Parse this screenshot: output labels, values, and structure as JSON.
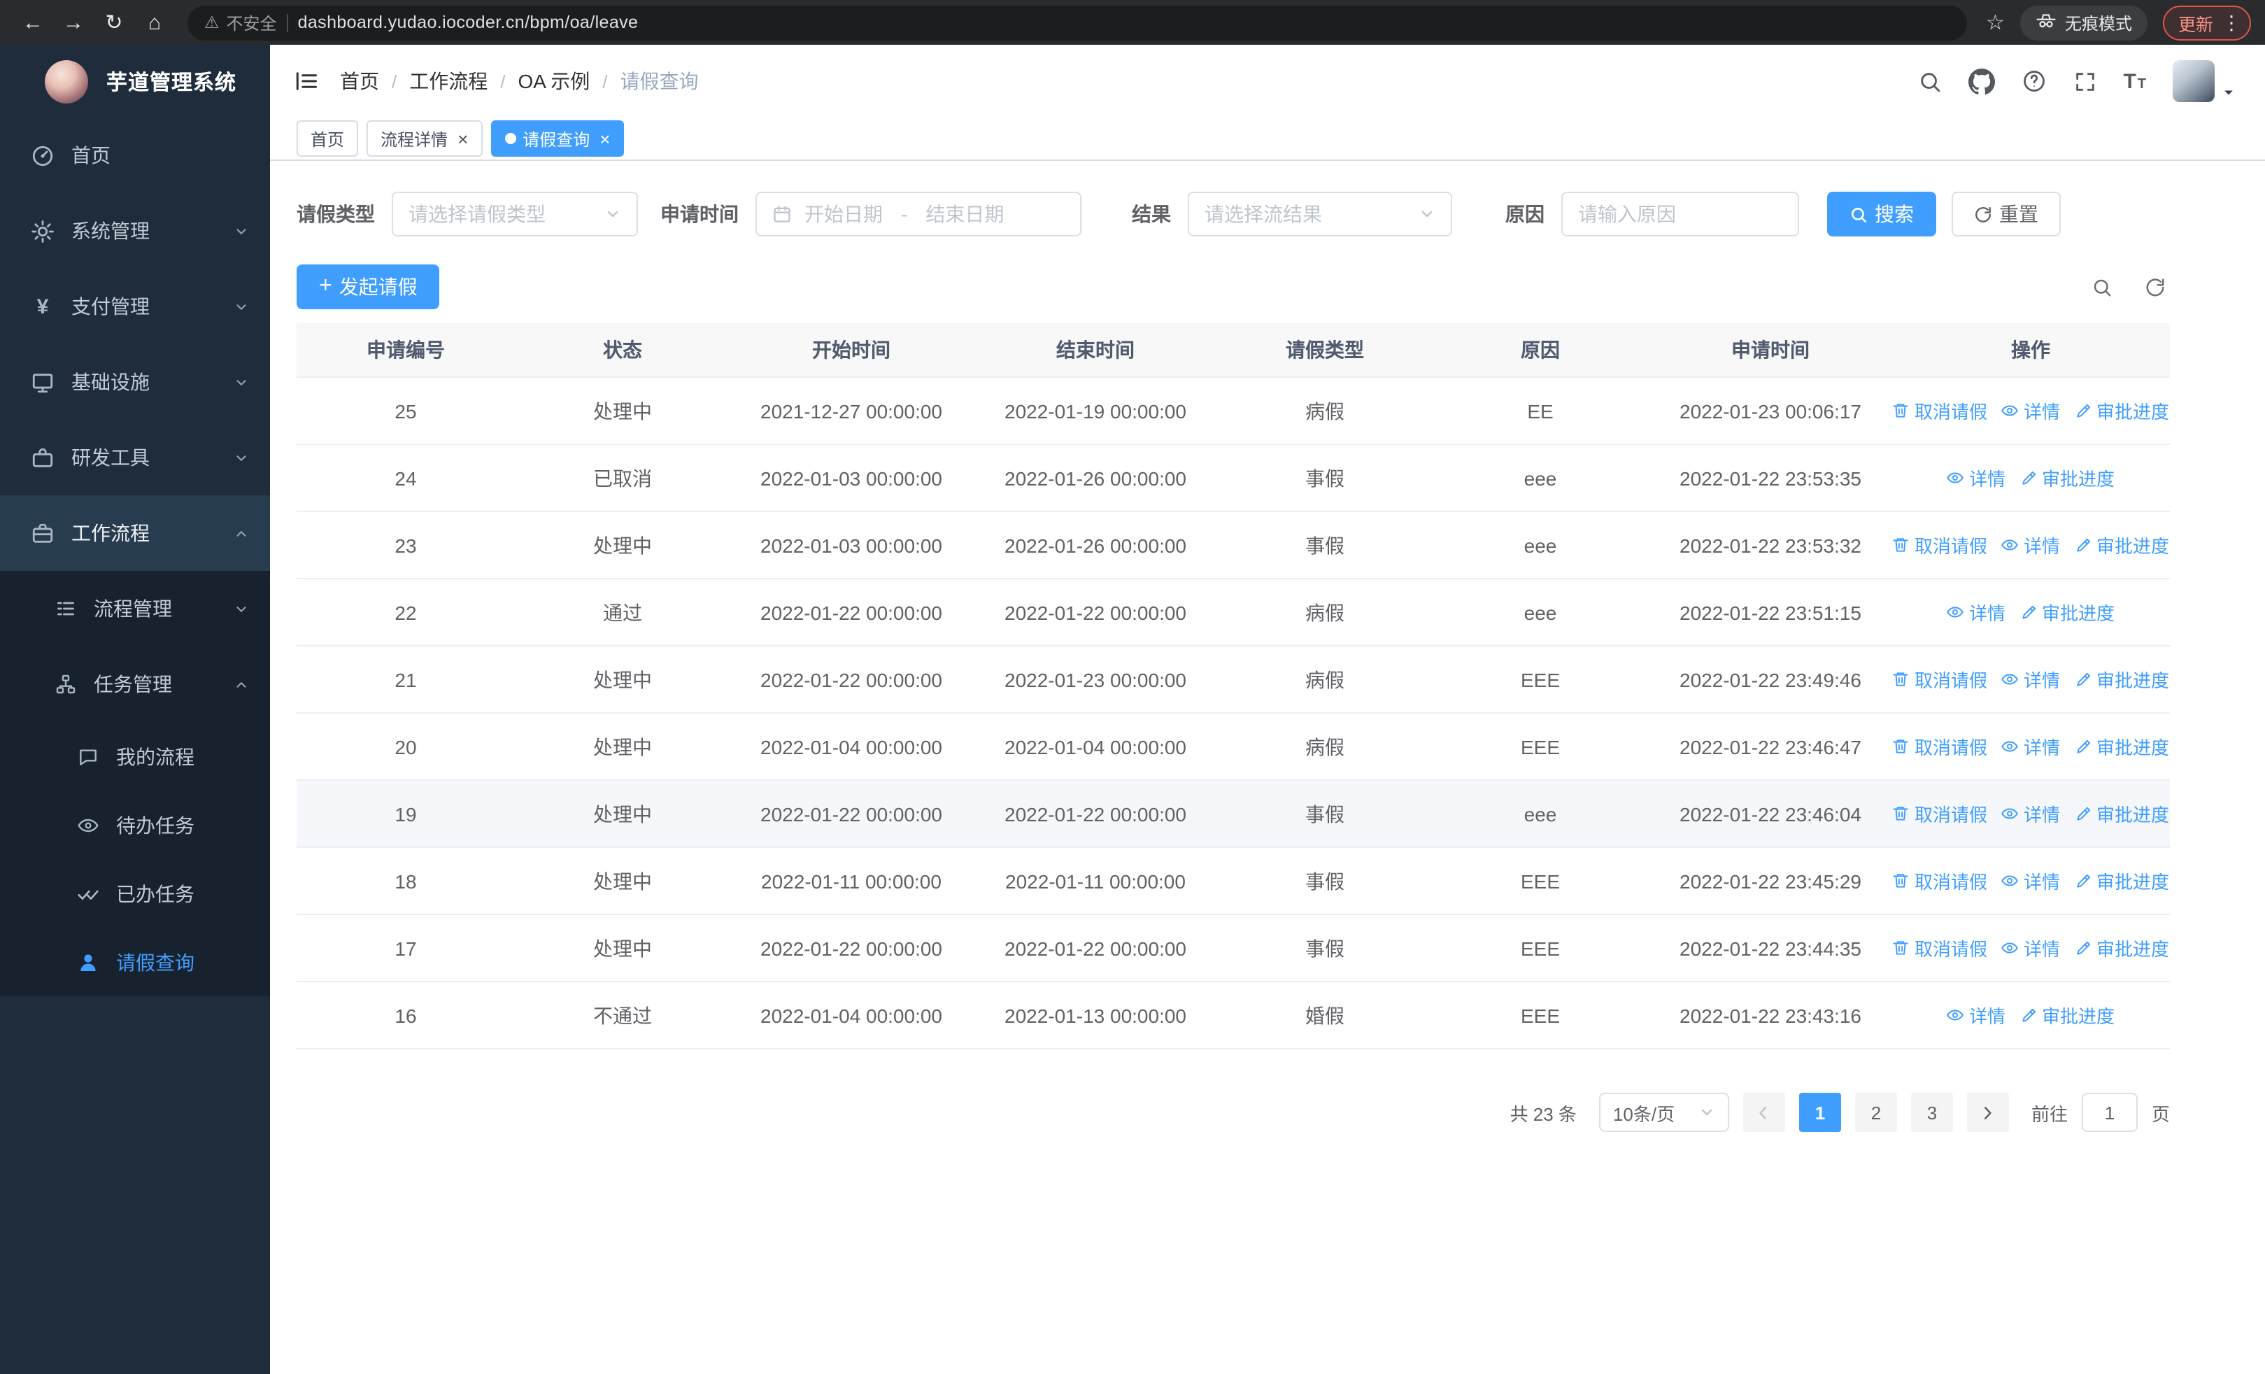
{
  "browser": {
    "security_warning": "不安全",
    "url": "dashboard.yudao.iocoder.cn/bpm/oa/leave",
    "incognito_label": "无痕模式",
    "update_label": "更新"
  },
  "sidebar": {
    "app_title": "芋道管理系统",
    "items": [
      {
        "key": "home",
        "label": "首页",
        "icon": "dashboard-icon",
        "level": 1
      },
      {
        "key": "system",
        "label": "系统管理",
        "icon": "gear-icon",
        "level": 1,
        "chevron": "down"
      },
      {
        "key": "payment",
        "label": "支付管理",
        "icon": "yen-icon",
        "level": 1,
        "chevron": "down"
      },
      {
        "key": "infra",
        "label": "基础设施",
        "icon": "monitor-icon",
        "level": 1,
        "chevron": "down"
      },
      {
        "key": "devtools",
        "label": "研发工具",
        "icon": "toolbox-icon",
        "level": 1,
        "chevron": "down"
      },
      {
        "key": "workflow",
        "label": "工作流程",
        "icon": "briefcase-icon",
        "level": 1,
        "chevron": "up",
        "open": true
      },
      {
        "key": "process-mgmt",
        "label": "流程管理",
        "icon": "list-icon",
        "level": 2,
        "chevron": "down"
      },
      {
        "key": "task-mgmt",
        "label": "任务管理",
        "icon": "org-icon",
        "level": 2,
        "chevron": "up",
        "open": true
      },
      {
        "key": "my-process",
        "label": "我的流程",
        "icon": "chat-icon",
        "level": 3
      },
      {
        "key": "todo-task",
        "label": "待办任务",
        "icon": "eye-icon",
        "level": 3
      },
      {
        "key": "done-task",
        "label": "已办任务",
        "icon": "double-check-icon",
        "level": 3
      },
      {
        "key": "leave-query",
        "label": "请假查询",
        "icon": "user-icon",
        "level": 3,
        "active": true
      }
    ]
  },
  "header": {
    "breadcrumb": [
      "首页",
      "工作流程",
      "OA 示例",
      "请假查询"
    ]
  },
  "tabs": [
    {
      "key": "home",
      "label": "首页",
      "closable": false,
      "active": false
    },
    {
      "key": "process-detail",
      "label": "流程详情",
      "closable": true,
      "active": false
    },
    {
      "key": "leave-query",
      "label": "请假查询",
      "closable": true,
      "active": true
    }
  ],
  "filters": {
    "leave_type_label": "请假类型",
    "leave_type_placeholder": "请选择请假类型",
    "apply_time_label": "申请时间",
    "start_date_placeholder": "开始日期",
    "date_separator": "-",
    "end_date_placeholder": "结束日期",
    "result_label": "结果",
    "result_placeholder": "请选择流结果",
    "reason_label": "原因",
    "reason_placeholder": "请输入原因",
    "search_label": "搜索",
    "reset_label": "重置"
  },
  "toolbar": {
    "create_label": "发起请假"
  },
  "table": {
    "columns": [
      "申请编号",
      "状态",
      "开始时间",
      "结束时间",
      "请假类型",
      "原因",
      "申请时间",
      "操作"
    ],
    "action_labels": {
      "cancel": "取消请假",
      "detail": "详情",
      "progress": "审批进度"
    },
    "highlight_row_id": "19",
    "rows": [
      {
        "id": "25",
        "status": "处理中",
        "start": "2021-12-27 00:00:00",
        "end": "2022-01-19 00:00:00",
        "type": "病假",
        "reason": "EE",
        "applied": "2022-01-23 00:06:17",
        "actions": [
          "cancel",
          "detail",
          "progress"
        ]
      },
      {
        "id": "24",
        "status": "已取消",
        "start": "2022-01-03 00:00:00",
        "end": "2022-01-26 00:00:00",
        "type": "事假",
        "reason": "eee",
        "applied": "2022-01-22 23:53:35",
        "actions": [
          "detail",
          "progress"
        ]
      },
      {
        "id": "23",
        "status": "处理中",
        "start": "2022-01-03 00:00:00",
        "end": "2022-01-26 00:00:00",
        "type": "事假",
        "reason": "eee",
        "applied": "2022-01-22 23:53:32",
        "actions": [
          "cancel",
          "detail",
          "progress"
        ]
      },
      {
        "id": "22",
        "status": "通过",
        "start": "2022-01-22 00:00:00",
        "end": "2022-01-22 00:00:00",
        "type": "病假",
        "reason": "eee",
        "applied": "2022-01-22 23:51:15",
        "actions": [
          "detail",
          "progress"
        ]
      },
      {
        "id": "21",
        "status": "处理中",
        "start": "2022-01-22 00:00:00",
        "end": "2022-01-23 00:00:00",
        "type": "病假",
        "reason": "EEE",
        "applied": "2022-01-22 23:49:46",
        "actions": [
          "cancel",
          "detail",
          "progress"
        ]
      },
      {
        "id": "20",
        "status": "处理中",
        "start": "2022-01-04 00:00:00",
        "end": "2022-01-04 00:00:00",
        "type": "病假",
        "reason": "EEE",
        "applied": "2022-01-22 23:46:47",
        "actions": [
          "cancel",
          "detail",
          "progress"
        ]
      },
      {
        "id": "19",
        "status": "处理中",
        "start": "2022-01-22 00:00:00",
        "end": "2022-01-22 00:00:00",
        "type": "事假",
        "reason": "eee",
        "applied": "2022-01-22 23:46:04",
        "actions": [
          "cancel",
          "detail",
          "progress"
        ]
      },
      {
        "id": "18",
        "status": "处理中",
        "start": "2022-01-11 00:00:00",
        "end": "2022-01-11 00:00:00",
        "type": "事假",
        "reason": "EEE",
        "applied": "2022-01-22 23:45:29",
        "actions": [
          "cancel",
          "detail",
          "progress"
        ]
      },
      {
        "id": "17",
        "status": "处理中",
        "start": "2022-01-22 00:00:00",
        "end": "2022-01-22 00:00:00",
        "type": "事假",
        "reason": "EEE",
        "applied": "2022-01-22 23:44:35",
        "actions": [
          "cancel",
          "detail",
          "progress"
        ]
      },
      {
        "id": "16",
        "status": "不通过",
        "start": "2022-01-04 00:00:00",
        "end": "2022-01-13 00:00:00",
        "type": "婚假",
        "reason": "EEE",
        "applied": "2022-01-22 23:43:16",
        "actions": [
          "detail",
          "progress"
        ]
      }
    ]
  },
  "pagination": {
    "total_text": "共 23 条",
    "page_size": "10条/页",
    "pages": [
      "1",
      "2",
      "3"
    ],
    "active_page": "1",
    "goto_label": "前往",
    "goto_value": "1",
    "page_label": "页"
  }
}
